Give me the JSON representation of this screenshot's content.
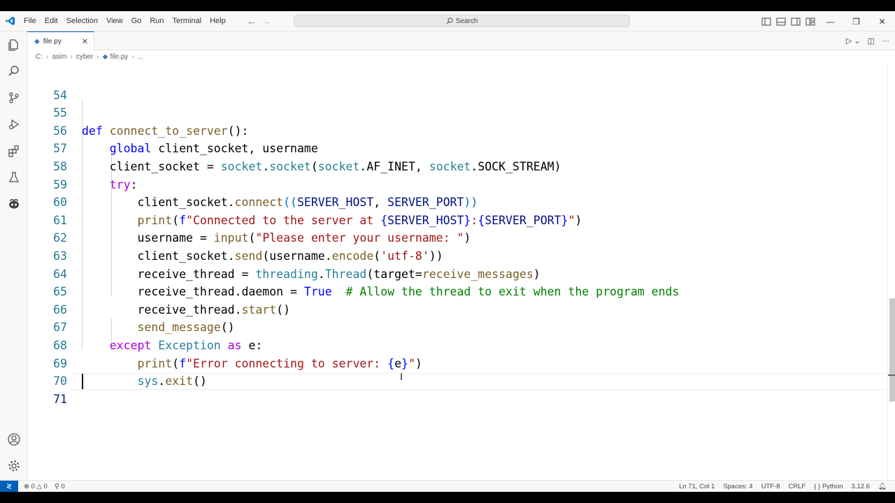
{
  "menu": [
    "File",
    "Edit",
    "Selection",
    "View",
    "Go",
    "Run",
    "Terminal",
    "Help"
  ],
  "search": {
    "label": "Search"
  },
  "tab": {
    "filename": "file.py",
    "close": "✕"
  },
  "breadcrumb": {
    "drive": "C:",
    "folder1": "asim",
    "folder2": "cyber",
    "file": "file.py",
    "more": "..."
  },
  "code": {
    "lines": [
      {
        "n": "54"
      },
      {
        "n": "55"
      },
      {
        "n": "56"
      },
      {
        "n": "57"
      },
      {
        "n": "58"
      },
      {
        "n": "59"
      },
      {
        "n": "60"
      },
      {
        "n": "61"
      },
      {
        "n": "62"
      },
      {
        "n": "63"
      },
      {
        "n": "64"
      },
      {
        "n": "65"
      },
      {
        "n": "66"
      },
      {
        "n": "67"
      },
      {
        "n": "68"
      },
      {
        "n": "69"
      },
      {
        "n": "70"
      },
      {
        "n": "71"
      }
    ],
    "tokens": {
      "l55": [
        "def",
        " ",
        "connect_to_server",
        "():"
      ],
      "l56": [
        "global",
        " client_socket, username"
      ],
      "l57": [
        "client_socket",
        " = ",
        "socket",
        ".",
        "socket",
        "(",
        "socket",
        ".",
        "AF_INET",
        ", ",
        "socket",
        ".",
        "SOCK_STREAM",
        ")"
      ],
      "l58": [
        "try",
        ":"
      ],
      "l59": [
        "client_socket",
        ".",
        "connect",
        "((",
        "SERVER_HOST",
        ", ",
        "SERVER_PORT",
        "))"
      ],
      "l60": [
        "print",
        "(",
        "f",
        "\"Connected to the server at ",
        "{",
        "SERVER_HOST",
        "}",
        ":",
        "{",
        "SERVER_PORT",
        "}",
        "\"",
        ")"
      ],
      "l61": [
        "username",
        " = ",
        "input",
        "(",
        "\"Please enter your username: \"",
        ")"
      ],
      "l62": [
        "client_socket",
        ".",
        "send",
        "(",
        "username",
        ".",
        "encode",
        "(",
        "'utf-8'",
        "))"
      ],
      "l63": [
        "receive_thread",
        " = ",
        "threading",
        ".",
        "Thread",
        "(",
        "target",
        "=",
        "receive_messages",
        ")"
      ],
      "l64": [
        "receive_thread",
        ".",
        "daemon",
        " = ",
        "True",
        "  ",
        "# Allow the thread to exit when the program ends"
      ],
      "l65": [
        "receive_thread",
        ".",
        "start",
        "()"
      ],
      "l66": [
        "send_message",
        "()"
      ],
      "l67": [
        "except",
        " ",
        "Exception",
        " ",
        "as",
        " ",
        "e",
        ":"
      ],
      "l68": [
        "print",
        "(",
        "f",
        "\"Error connecting to server: ",
        "{",
        "e",
        "}",
        "\"",
        ")"
      ],
      "l69": [
        "sys",
        ".",
        "exit",
        "()"
      ]
    }
  },
  "status": {
    "errors": "0",
    "warnings": "0",
    "ports": "0",
    "position": "Ln 71, Col 1",
    "spaces": "Spaces: 4",
    "encoding": "UTF-8",
    "eol": "CRLF",
    "language": "Python",
    "version": "3.12.6"
  },
  "colors": {
    "accent": "#005fb8",
    "keyword": "#0000ff",
    "control": "#af00db",
    "function": "#795e26",
    "variable": "#001080",
    "string": "#a31515",
    "comment": "#008000",
    "type": "#267f99"
  }
}
